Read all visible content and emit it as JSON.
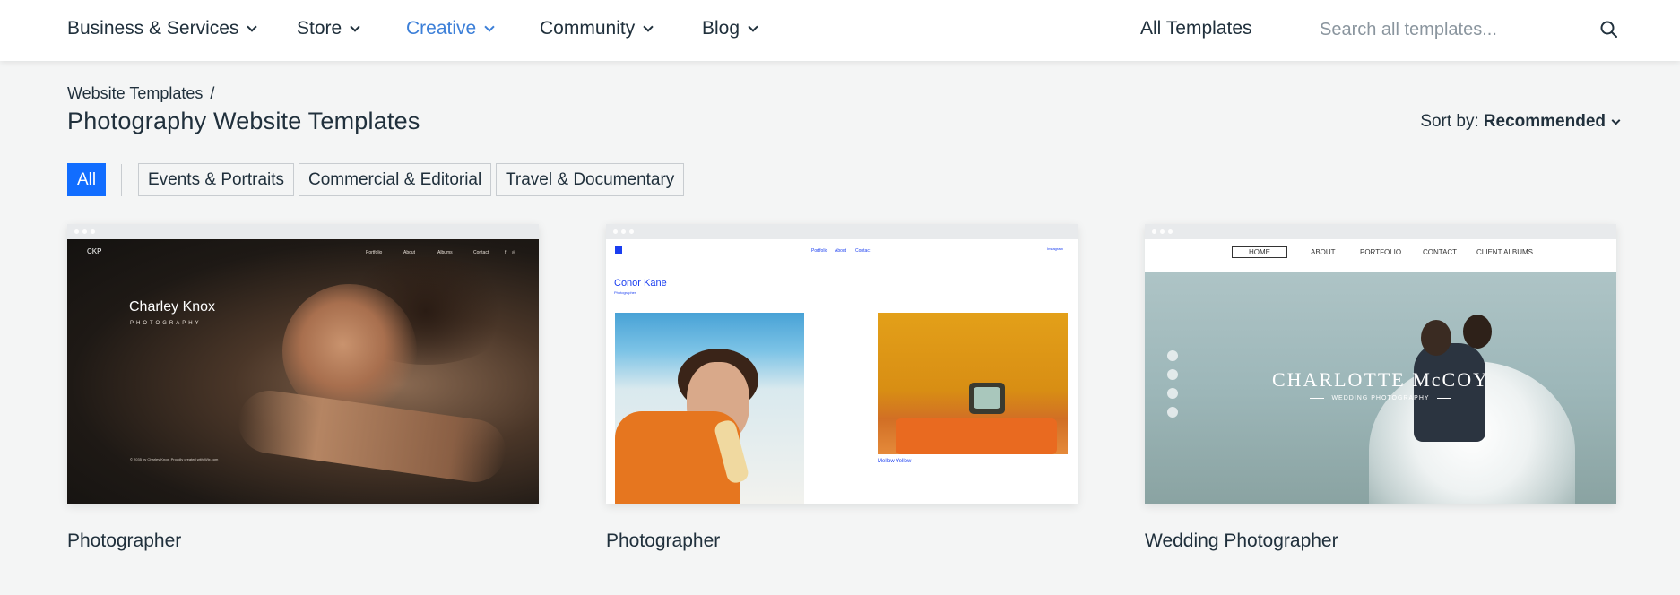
{
  "nav": {
    "items": [
      {
        "label": "Business & Services",
        "active": false
      },
      {
        "label": "Store",
        "active": false
      },
      {
        "label": "Creative",
        "active": true
      },
      {
        "label": "Community",
        "active": false
      },
      {
        "label": "Blog",
        "active": false
      }
    ],
    "all_templates_label": "All Templates",
    "search_placeholder": "Search all templates..."
  },
  "breadcrumb": {
    "parent": "Website Templates",
    "separator": "/"
  },
  "page_title": "Photography Website Templates",
  "sort": {
    "label": "Sort by:",
    "value": "Recommended"
  },
  "filters": [
    {
      "label": "All",
      "selected": true
    },
    {
      "label": "Events & Portraits",
      "selected": false
    },
    {
      "label": "Commercial & Editorial",
      "selected": false
    },
    {
      "label": "Travel & Documentary",
      "selected": false
    }
  ],
  "templates": [
    {
      "title": "Photographer",
      "preview": {
        "logo": "CKP",
        "menu": [
          "Portfolio",
          "About",
          "Albums",
          "Contact"
        ],
        "name": "Charley Knox",
        "subtitle": "PHOTOGRAPHY",
        "footer": "© 2035 by Charley Knox. Proudly created with Wix.com"
      }
    },
    {
      "title": "Photographer",
      "preview": {
        "menu": [
          "Portfolio",
          "About",
          "Contact"
        ],
        "social": "Instagram",
        "name": "Conor Kane",
        "subtitle": "Photographer",
        "caption": "Mellow Yellow"
      }
    },
    {
      "title": "Wedding Photographer",
      "preview": {
        "menu": [
          "HOME",
          "ABOUT",
          "PORTFOLIO",
          "CONTACT",
          "CLIENT ALBUMS"
        ],
        "brand": "CHARLOTTE McCOY",
        "brand_subtitle": "WEDDING PHOTOGRAPHY"
      }
    }
  ],
  "colors": {
    "accent": "#116dff",
    "nav_active": "#3c7fd8",
    "text": "#20303c",
    "page_bg": "#f4f5f5"
  }
}
